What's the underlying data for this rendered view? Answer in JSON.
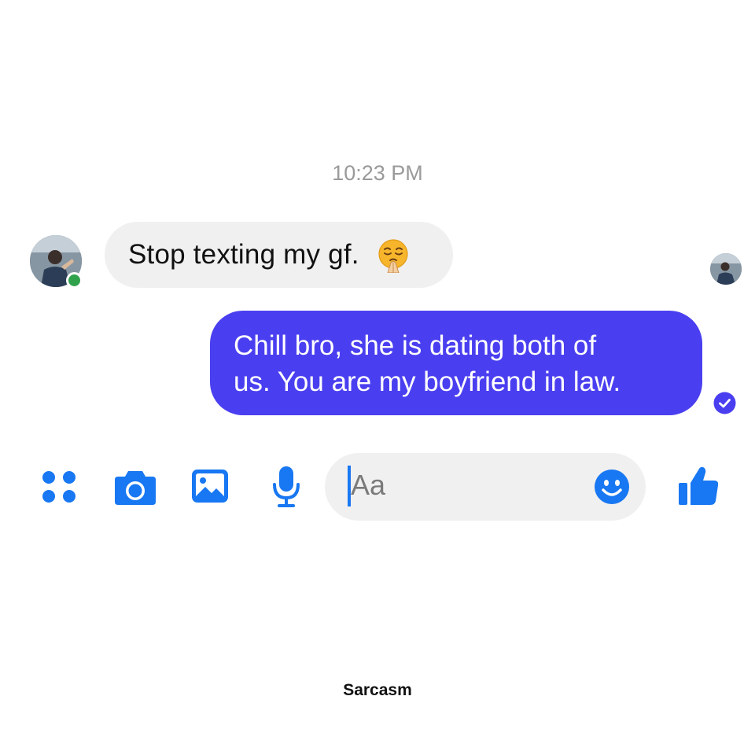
{
  "conversation": {
    "timestamp": "10:23 PM",
    "messages": [
      {
        "direction": "incoming",
        "text": "Stop texting my gf.",
        "emoji": "pleading-face-emoji"
      },
      {
        "direction": "outgoing",
        "lines": [
          "Chill bro, she is dating both of",
          "us. You are my boyfriend in law."
        ]
      }
    ]
  },
  "composer": {
    "placeholder": "Aa",
    "icons": [
      "apps-icon",
      "camera-icon",
      "image-icon",
      "microphone-icon",
      "emoji-icon",
      "thumbs-up-icon"
    ]
  },
  "footer": {
    "caption": "Sarcasm"
  },
  "colors": {
    "accent": "#1877f2",
    "outgoing_bubble": "#4a3ff0",
    "incoming_bubble": "#f1f0f0",
    "online": "#31a24c",
    "timestamp": "#9a9a9a"
  }
}
